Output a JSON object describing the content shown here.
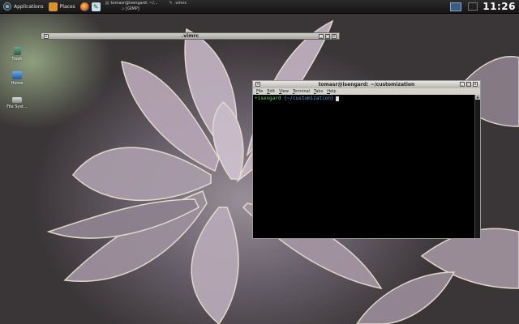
{
  "panel": {
    "applications": "Applications",
    "places": "Places",
    "tasks": [
      {
        "label": "tomasr@isengard: ~/...",
        "glyph": "▤"
      },
      {
        "label": ".vimrc",
        "glyph": "✎"
      },
      {
        "label": "[GIMP]",
        "glyph": "▫"
      }
    ],
    "clock": "11:26"
  },
  "desktop": {
    "icons": [
      {
        "label": "Trash"
      },
      {
        "label": "Home"
      },
      {
        "label": "File Syst..."
      }
    ]
  },
  "windows": {
    "vimrc": {
      "title": ".vimrc"
    },
    "terminal": {
      "title": "tomasr@isengard: ~/customization",
      "menu": [
        "File",
        "Edit",
        "View",
        "Terminal",
        "Tabs",
        "Help"
      ],
      "prompt_host": "+isengard",
      "prompt_path": "{~/customization}"
    }
  },
  "colors": {
    "prompt_host": "#5bdc5b",
    "prompt_path": "#5ba8dc",
    "terminal_bg": "#000000"
  }
}
